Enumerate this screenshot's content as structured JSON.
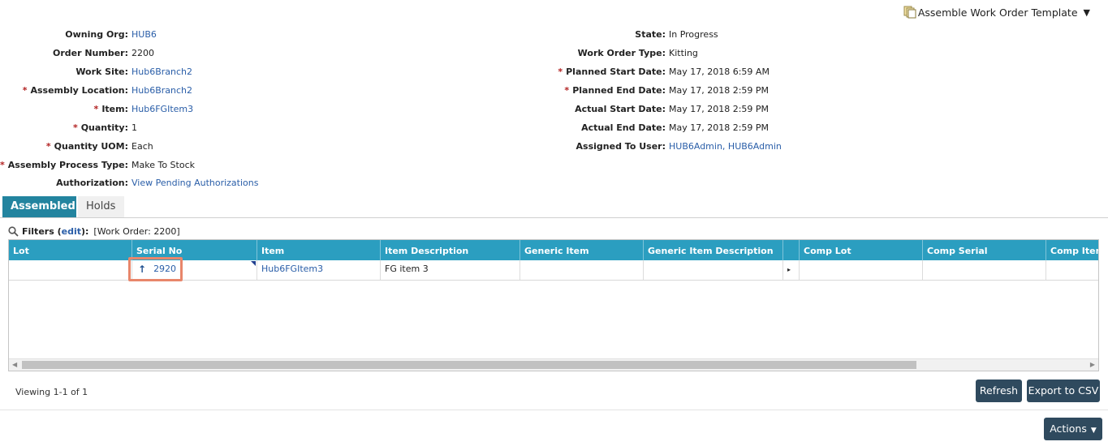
{
  "template": {
    "label": "Assemble Work Order Template",
    "icon": "template-icon",
    "caret": "▼"
  },
  "left_fields": [
    {
      "label": "Owning Org:",
      "value": "HUB6",
      "required": false,
      "link": true
    },
    {
      "label": "Order Number:",
      "value": "2200",
      "required": false,
      "link": false
    },
    {
      "label": "Work Site:",
      "value": "Hub6Branch2",
      "required": false,
      "link": true
    },
    {
      "label": "Assembly Location:",
      "value": "Hub6Branch2",
      "required": true,
      "link": true
    },
    {
      "label": "Item:",
      "value": "Hub6FGItem3",
      "required": true,
      "link": true
    },
    {
      "label": "Quantity:",
      "value": "1",
      "required": true,
      "link": false
    },
    {
      "label": "Quantity UOM:",
      "value": "Each",
      "required": true,
      "link": false
    },
    {
      "label": "Assembly Process Type:",
      "value": "Make To Stock",
      "required": true,
      "link": false
    },
    {
      "label": "Authorization:",
      "value": "View Pending Authorizations",
      "required": false,
      "link": true
    }
  ],
  "right_fields": [
    {
      "label": "State:",
      "value": "In Progress",
      "required": false,
      "link": false
    },
    {
      "label": "Work Order Type:",
      "value": "Kitting",
      "required": false,
      "link": false
    },
    {
      "label": "Planned Start Date:",
      "value": "May 17, 2018 6:59 AM",
      "required": true,
      "link": false
    },
    {
      "label": "Planned End Date:",
      "value": "May 17, 2018 2:59 PM",
      "required": true,
      "link": false
    },
    {
      "label": "Actual Start Date:",
      "value": "May 17, 2018 2:59 PM",
      "required": false,
      "link": false
    },
    {
      "label": "Actual End Date:",
      "value": "May 17, 2018 2:59 PM",
      "required": false,
      "link": false
    },
    {
      "label": "Assigned To User:",
      "value": "HUB6Admin, HUB6Admin",
      "required": false,
      "link": true
    }
  ],
  "required_marker": "*",
  "tabs": [
    {
      "label": "Assembled",
      "active": true
    },
    {
      "label": "Holds",
      "active": false
    }
  ],
  "filters": {
    "label": "Filters",
    "open_paren": " (",
    "edit_label": "edit",
    "close_paren": "):",
    "value": "[Work Order: 2200]"
  },
  "grid": {
    "columns": [
      "Lot",
      "Serial No",
      "Item",
      "Item Description",
      "Generic Item",
      "Generic Item Description",
      "",
      "Comp Lot",
      "Comp Serial",
      "Comp Item"
    ],
    "rows": [
      {
        "lot": "",
        "serial_no": "2920",
        "serial_icon": "up-arrow-icon",
        "item": "Hub6FGItem3",
        "item_description": "FG item 3",
        "generic_item": "",
        "generic_item_description": "",
        "expander": "▸",
        "comp_lot": "",
        "comp_serial": "",
        "comp_item": ""
      }
    ]
  },
  "footer": {
    "viewing": "Viewing 1-1 of 1",
    "refresh_label": "Refresh",
    "export_label": "Export to CSV",
    "actions_label": "Actions",
    "actions_caret": "▼"
  },
  "colors": {
    "tab_active": "#23849f",
    "grid_header": "#2b9ec0",
    "button": "#2f4a5e",
    "link": "#2a5ea8",
    "required": "#b22222",
    "highlight": "#e8866b"
  }
}
